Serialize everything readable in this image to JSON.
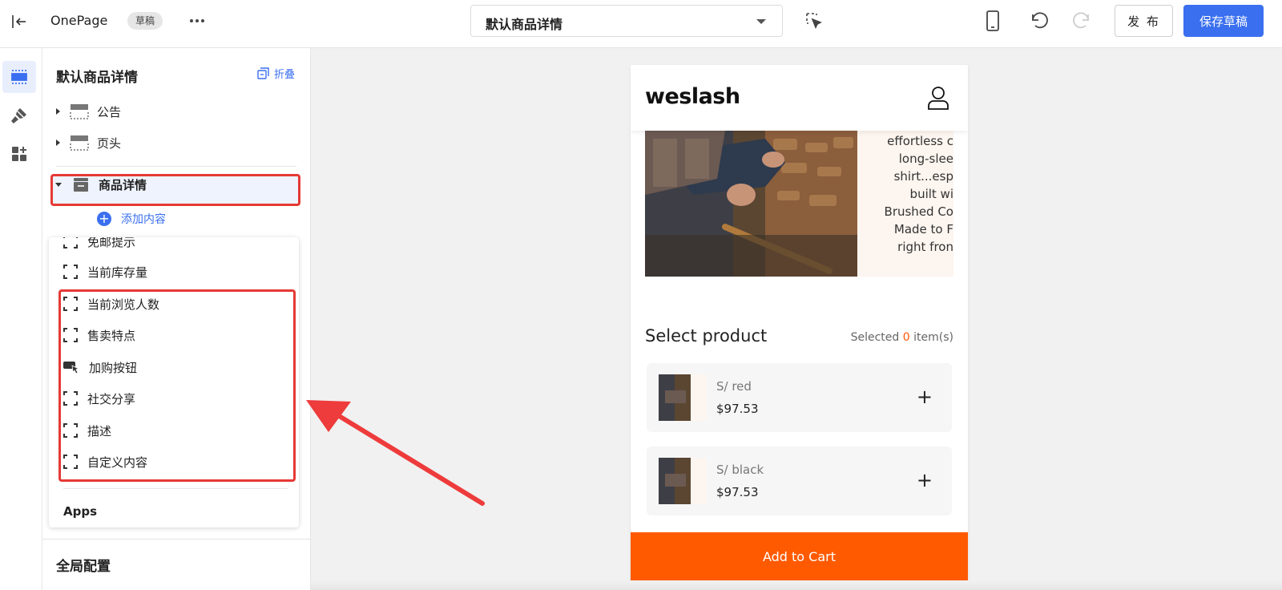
{
  "topbar": {
    "app_name": "OnePage",
    "status_badge": "草稿",
    "template_select": "默认商品详情",
    "publish_label": "发 布",
    "save_label": "保存草稿"
  },
  "panel": {
    "title": "默认商品详情",
    "fold_label": "折叠",
    "tree": [
      {
        "label": "公告"
      },
      {
        "label": "页头"
      },
      {
        "label": "商品详情"
      }
    ],
    "add_content_label": "添加内容",
    "dropdown_items": [
      "免邮提示",
      "当前库存量",
      "当前浏览人数",
      "售卖特点",
      "加购按钮",
      "社交分享",
      "描述",
      "自定义内容"
    ],
    "apps_label": "Apps",
    "global_config_label": "全局配置"
  },
  "preview": {
    "logo": "weslash",
    "description_lines": [
      "effortless c",
      "long-slee",
      "shirt...esp",
      "built wi",
      "Brushed Co",
      "Made to F",
      "right fron"
    ],
    "select_title": "Select product",
    "selected_prefix": "Selected",
    "selected_count": "0",
    "selected_suffix": "item(s)",
    "products": [
      {
        "variant": "S/ red",
        "price": "$97.53"
      },
      {
        "variant": "S/ black",
        "price": "$97.53"
      }
    ],
    "cart_label": "Add to Cart"
  },
  "colors": {
    "accent": "#3a6ff0",
    "highlight": "#e53935",
    "cart": "#ff5a00"
  }
}
